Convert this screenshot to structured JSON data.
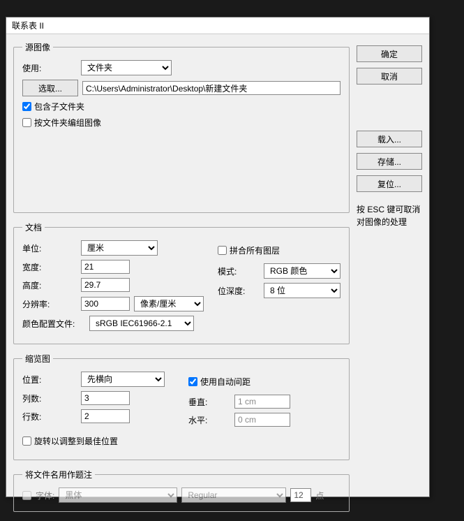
{
  "title": "联系表 II",
  "buttons": {
    "ok": "确定",
    "cancel": "取消",
    "load": "载入...",
    "save": "存储...",
    "reset": "复位..."
  },
  "hint": "按 ESC 键可取消对图像的处理",
  "source": {
    "legend": "源图像",
    "use_label": "使用:",
    "use_value": "文件夹",
    "choose_btn": "选取...",
    "path": "C:\\Users\\Administrator\\Desktop\\新建文件夹",
    "include_sub": "包含子文件夹",
    "group_by_folder": "按文件夹编组图像"
  },
  "document": {
    "legend": "文档",
    "unit_label": "单位:",
    "unit_value": "厘米",
    "flatten": "拼合所有图层",
    "width_label": "宽度:",
    "width_value": "21",
    "mode_label": "模式:",
    "mode_value": "RGB 颜色",
    "height_label": "高度:",
    "height_value": "29.7",
    "depth_label": "位深度:",
    "depth_value": "8 位",
    "res_label": "分辨率:",
    "res_value": "300",
    "res_unit": "像素/厘米",
    "profile_label": "颜色配置文件:",
    "profile_value": "sRGB IEC61966-2.1"
  },
  "thumb": {
    "legend": "缩览图",
    "pos_label": "位置:",
    "pos_value": "先横向",
    "auto_spacing": "使用自动间距",
    "cols_label": "列数:",
    "cols_value": "3",
    "vert_label": "垂直:",
    "vert_value": "1 cm",
    "rows_label": "行数:",
    "rows_value": "2",
    "horiz_label": "水平:",
    "horiz_value": "0 cm",
    "rotate": "旋转以调整到最佳位置"
  },
  "caption": {
    "legend": "将文件名用作题注",
    "font_label": "字体:",
    "font_value": "黑体",
    "style_value": "Regular",
    "size_value": "12",
    "size_unit": "点"
  }
}
